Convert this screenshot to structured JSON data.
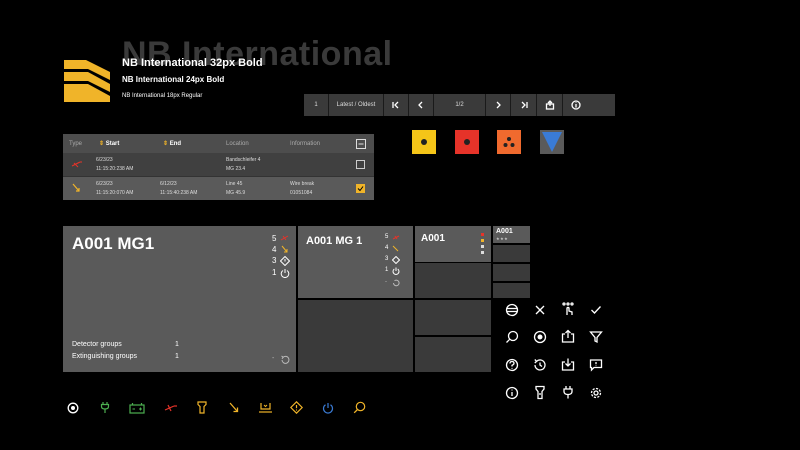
{
  "typography": {
    "ghost": "NB International",
    "bold32": "NB International 32px Bold",
    "bold24": "NB International 24px Bold",
    "regular18": "NB International 18px Regular"
  },
  "toolbar": {
    "page_number": "1",
    "sort": "Latest / Oldest",
    "pager": "1/2"
  },
  "table": {
    "headers": [
      "Type",
      "Start",
      "End",
      "Location",
      "Information"
    ],
    "rows": [
      {
        "start_date": "6/23/23",
        "start_time": "11:15:20:238 AM",
        "end_date": "",
        "end_time": "",
        "location1": "Bandschleifer 4",
        "location2": "MG 23.4",
        "info1": "",
        "info2": "",
        "checked": false
      },
      {
        "start_date": "6/23/23",
        "start_time": "11:15:20:070 AM",
        "end_date": "6/12/23",
        "end_time": "11:15:40:238 AM",
        "location1": "Line 45",
        "location2": "MG 45.9",
        "info1": "Wire break",
        "info2": "01051084",
        "checked": true
      }
    ]
  },
  "status_colors": [
    "#f5c518",
    "#e63329",
    "#f06a2e",
    "#3a7bd5"
  ],
  "card_large": {
    "title": "A001 MG1",
    "counts": [
      "5",
      "4",
      "3",
      "1"
    ],
    "detector_label": "Detector groups",
    "detector_value": "1",
    "extinguishing_label": "Extinguishing groups",
    "extinguishing_value": "1",
    "dash": "-"
  },
  "card_medium": {
    "title": "A001 MG 1",
    "counts": [
      "5",
      "4",
      "3",
      "1",
      "-"
    ]
  },
  "card_small": {
    "title": "A001"
  },
  "card_tiny": {
    "title": "A001",
    "stars": "★★★"
  },
  "icons_grid": [
    "strikethrough-icon",
    "close-icon",
    "touch-icon",
    "check-icon",
    "search-icon",
    "target-icon",
    "share-icon",
    "filter-icon",
    "help-icon",
    "history-icon",
    "download-icon",
    "message-icon",
    "info-icon",
    "torch-icon",
    "plug-icon",
    "settings-icon"
  ],
  "bottom_icons": [
    "target-icon",
    "plug-icon",
    "battery-icon",
    "fault-icon",
    "torch-icon",
    "alarm-icon",
    "device-icon",
    "warning-icon",
    "power-icon",
    "search-icon"
  ]
}
